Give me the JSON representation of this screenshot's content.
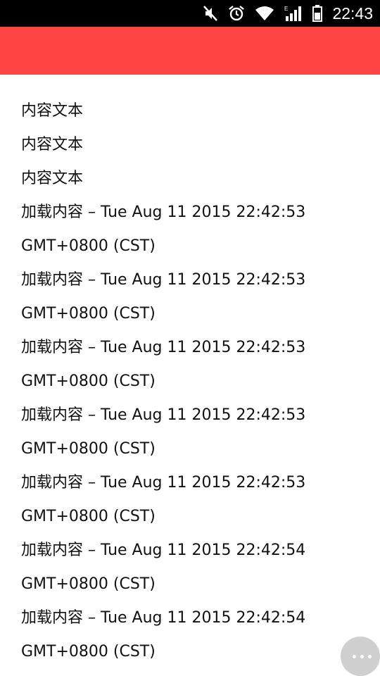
{
  "status_bar": {
    "time": "22:43",
    "icons": [
      "mute-icon",
      "alarm-icon",
      "wifi-icon",
      "signal-icon",
      "battery-icon"
    ],
    "signal_type": "E"
  },
  "app_bar": {
    "color": "#ff4444"
  },
  "content_lines": [
    "内容文本",
    "内容文本",
    "内容文本"
  ],
  "loaded_items": [
    {
      "line1": "加载内容 – Tue Aug 11 2015 22:42:53",
      "line2": "GMT+0800 (CST)"
    },
    {
      "line1": "加载内容 – Tue Aug 11 2015 22:42:53",
      "line2": "GMT+0800 (CST)"
    },
    {
      "line1": "加载内容 – Tue Aug 11 2015 22:42:53",
      "line2": "GMT+0800 (CST)"
    },
    {
      "line1": "加载内容 – Tue Aug 11 2015 22:42:53",
      "line2": "GMT+0800 (CST)"
    },
    {
      "line1": "加载内容 – Tue Aug 11 2015 22:42:53",
      "line2": "GMT+0800 (CST)"
    },
    {
      "line1": "加载内容 – Tue Aug 11 2015 22:42:54",
      "line2": "GMT+0800 (CST)"
    },
    {
      "line1": "加载内容 – Tue Aug 11 2015 22:42:54",
      "line2": "GMT+0800 (CST)"
    }
  ],
  "floating_button": {
    "icon": "more-horizontal-icon"
  }
}
